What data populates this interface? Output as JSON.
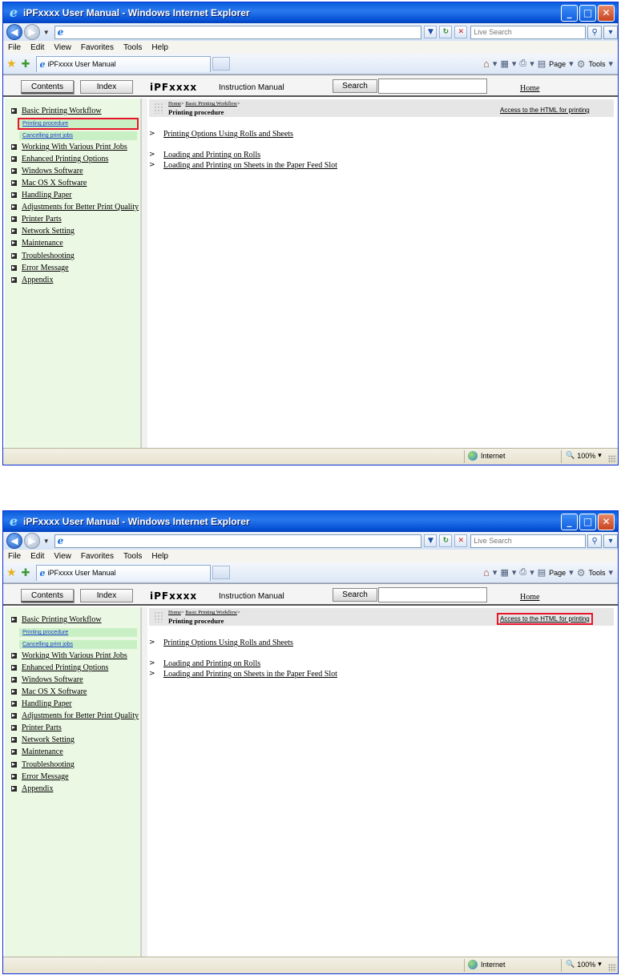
{
  "window": {
    "title": "iPFxxxx User Manual - Windows Internet Explorer",
    "title_buttons": [
      "_",
      "□",
      "✕"
    ]
  },
  "browser": {
    "address": "",
    "search_placeholder": "Live Search",
    "menu": [
      "File",
      "Edit",
      "View",
      "Favorites",
      "Tools",
      "Help"
    ],
    "tab_label": "iPFxxxx User Manual",
    "page_menu": "Page",
    "tools_menu": "Tools"
  },
  "header": {
    "contents_tab": "Contents",
    "index_tab": "Index",
    "brand": "iPFxxxx",
    "manual_title": "Instruction Manual",
    "search_button": "Search",
    "home_link": "Home"
  },
  "sidebar": {
    "top_item": "Basic Printing Workflow",
    "sub_items": [
      "Printing procedure",
      "Cancelling print jobs"
    ],
    "items": [
      "Working With Various Print Jobs",
      "Enhanced Printing Options",
      "Windows Software",
      "Mac OS X Software",
      "Handling Paper",
      "Adjustments for Better Print Quality",
      "Printer Parts",
      "Network Setting",
      "Maintenance",
      "Troubleshooting",
      "Error Message",
      "Appendix"
    ]
  },
  "main": {
    "breadcrumb_home": "Home",
    "breadcrumb_sep": ">",
    "breadcrumb_section": "Basic Printing Workflow",
    "page_title": "Printing procedure",
    "access_link": "Access to the HTML for printing",
    "links": [
      "Printing Options Using Rolls and Sheets",
      "Loading and Printing on Rolls",
      "Loading and Printing on Sheets in the Paper Feed Slot"
    ]
  },
  "status": {
    "zone": "Internet",
    "zoom": "100%"
  },
  "colors": {
    "highlight": "#e8152a",
    "sidebar_bg": "#ebf8e4",
    "titlebar": "#0a5ddc"
  }
}
